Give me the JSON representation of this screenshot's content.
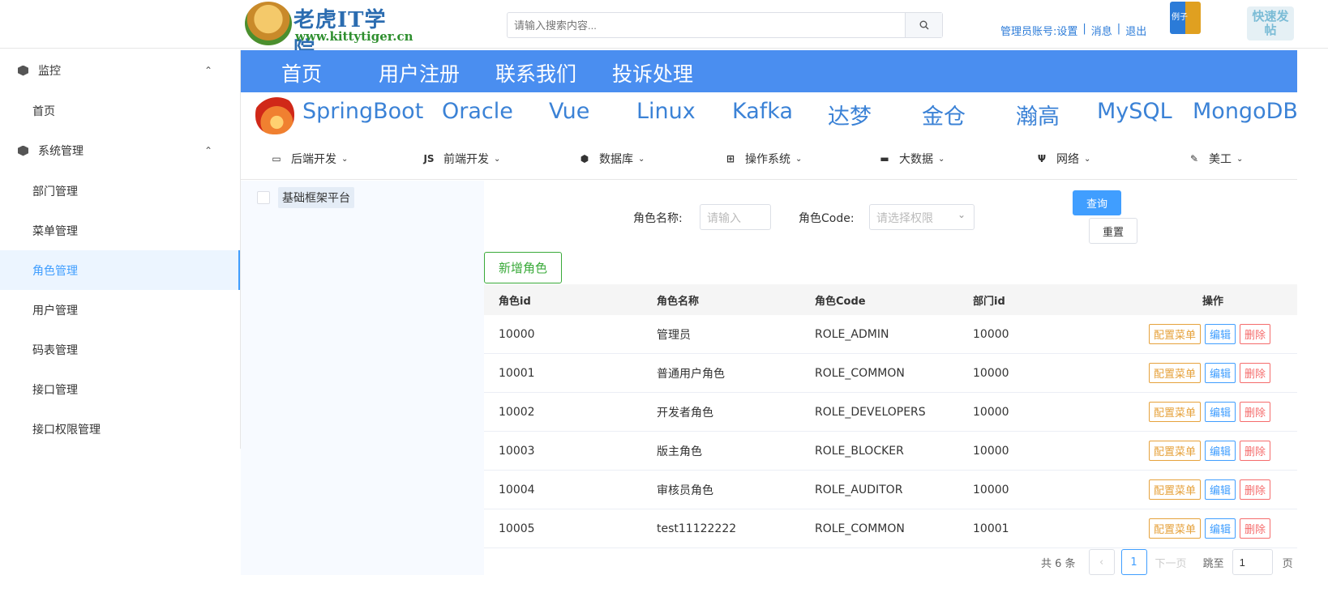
{
  "header": {
    "logo_title": "老虎IT学院",
    "logo_url": "www.kittytiger.cn",
    "search_placeholder": "请输入搜索内容...",
    "account_settings": "管理员账号:设置",
    "messages": "消息",
    "logout": "退出",
    "separator": "|",
    "badge_text": "例子",
    "quick_post": "快速发帖"
  },
  "sidebar": {
    "groups": [
      {
        "label": "监控",
        "items": [
          "首页"
        ]
      },
      {
        "label": "系统管理",
        "items": [
          "部门管理",
          "菜单管理",
          "角色管理",
          "用户管理",
          "码表管理",
          "接口管理",
          "接口权限管理"
        ]
      }
    ],
    "active_item": "角色管理"
  },
  "topnav": [
    "首页",
    "用户注册",
    "联系我们",
    "投诉处理"
  ],
  "tech": [
    "SpringBoot",
    "Oracle",
    "Vue",
    "Linux",
    "Kafka",
    "达梦",
    "金仓",
    "瀚高",
    "MySQL",
    "MongoDB"
  ],
  "categories": [
    {
      "icon": "laptop-icon",
      "glyph": "▭",
      "label": "后端开发"
    },
    {
      "icon": "js-icon",
      "glyph": "JS",
      "label": "前端开发"
    },
    {
      "icon": "cube-icon",
      "glyph": "⬢",
      "label": "数据库"
    },
    {
      "icon": "windows-icon",
      "glyph": "⊞",
      "label": "操作系统"
    },
    {
      "icon": "briefcase-icon",
      "glyph": "▬",
      "label": "大数据"
    },
    {
      "icon": "network-icon",
      "glyph": "Ψ",
      "label": "网络"
    },
    {
      "icon": "brush-icon",
      "glyph": "✎",
      "label": "美工"
    }
  ],
  "tree": {
    "root_label": "基础框架平台"
  },
  "form": {
    "role_name_label": "角色名称:",
    "role_name_placeholder": "请输入",
    "role_code_label": "角色Code:",
    "role_code_placeholder": "请选择权限",
    "query_button": "查询",
    "reset_button": "重置",
    "add_button": "新增角色"
  },
  "table": {
    "columns": [
      "角色id",
      "角色名称",
      "角色Code",
      "部门id",
      "操作"
    ],
    "rows": [
      {
        "id": "10000",
        "name": "管理员",
        "code": "ROLE_ADMIN",
        "dept": "10000"
      },
      {
        "id": "10001",
        "name": "普通用户角色",
        "code": "ROLE_COMMON",
        "dept": "10000"
      },
      {
        "id": "10002",
        "name": "开发者角色",
        "code": "ROLE_DEVELOPERS",
        "dept": "10000"
      },
      {
        "id": "10003",
        "name": "版主角色",
        "code": "ROLE_BLOCKER",
        "dept": "10000"
      },
      {
        "id": "10004",
        "name": "审核员角色",
        "code": "ROLE_AUDITOR",
        "dept": "10000"
      },
      {
        "id": "10005",
        "name": "test11122222",
        "code": "ROLE_COMMON",
        "dept": "10001"
      }
    ],
    "actions": {
      "config": "配置菜单",
      "edit": "编辑",
      "delete": "删除"
    }
  },
  "pagination": {
    "total_text": "共 6 条",
    "prev": "‹",
    "current_page": "1",
    "next": "下一页",
    "goto_label": "跳至",
    "goto_value": "1",
    "page_suffix": "页"
  }
}
